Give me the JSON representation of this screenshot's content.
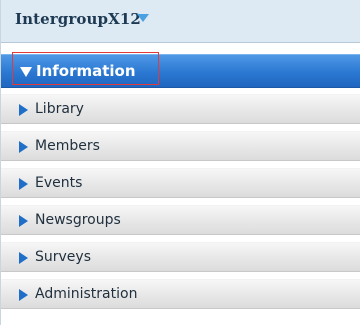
{
  "group": {
    "title": "IntergroupX12"
  },
  "menu": {
    "items": [
      {
        "label": "Information",
        "active": true
      },
      {
        "label": "Library"
      },
      {
        "label": "Members"
      },
      {
        "label": "Events"
      },
      {
        "label": "Newsgroups"
      },
      {
        "label": "Surveys"
      },
      {
        "label": "Administration"
      }
    ]
  },
  "colors": {
    "active_item": "#2a78d2",
    "arrow": "#1f6fc9",
    "highlight_outline": "#e03a3a"
  },
  "icons": {
    "group_toggle": "chevron-down-icon",
    "expanded_item": "triangle-down-icon",
    "collapsed_item": "triangle-right-icon"
  }
}
